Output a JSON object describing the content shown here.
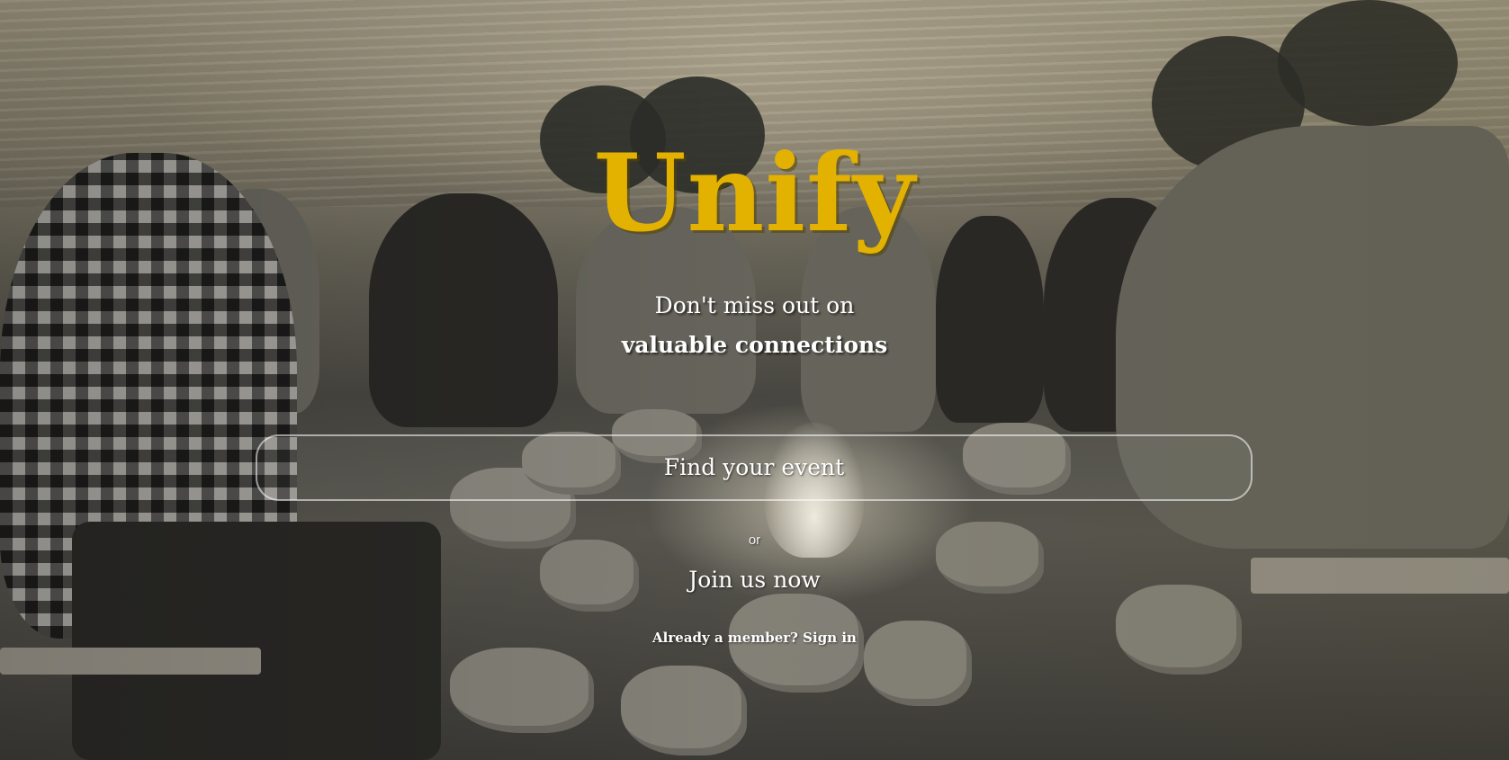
{
  "brand": {
    "logo_text": "Unify",
    "logo_color": "#e3b200"
  },
  "hero": {
    "tagline_line1": "Don't miss out on",
    "tagline_line2": "valuable connections",
    "find_event_label": "Find your event",
    "or_label": "or",
    "join_label": "Join us now",
    "member_prompt": "Already a member?",
    "sign_in_label": "Sign in"
  }
}
